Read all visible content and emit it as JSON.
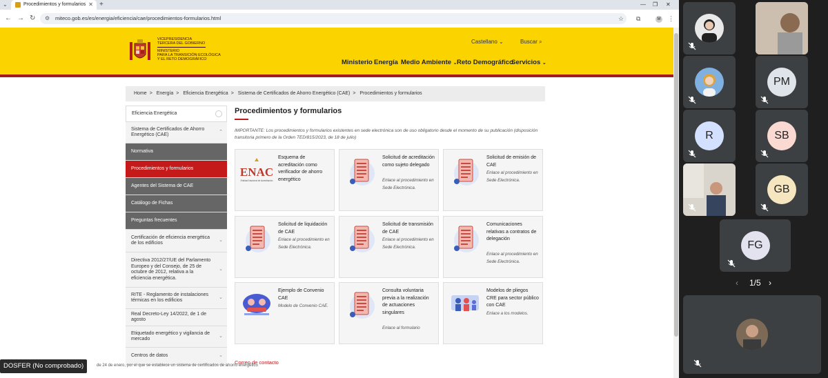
{
  "browser": {
    "tab_title": "Procedimientos y formularios",
    "url": "miteco.gob.es/es/energia/eficiencia/cae/procedimientos-formularios.html",
    "profile_initial": "M"
  },
  "header": {
    "org_line1": "VICEPRESIDENCIA",
    "org_line2": "TERCERA DEL GOBIERNO",
    "org_line3": "MINISTERIO",
    "org_line4": "PARA LA TRANSICIÓN ECOLÓGICA",
    "org_line5": "Y EL RETO DEMOGRÁFICO",
    "language": "Castellano",
    "search": "Buscar",
    "menu": [
      "Ministerio",
      "Energía",
      "Medio Ambiente",
      "Reto Demográfico",
      "Servicios"
    ]
  },
  "breadcrumb": [
    "Home",
    "Energía",
    "Eficiencia Energética",
    "Sistema de Certificados de Ahorro Energético (CAE)",
    "Procedimientos y formularios"
  ],
  "sidebar": [
    "Eficiencia Energética",
    "Sistema de Certificados de Ahorro Energético (CAE)",
    "Normativa",
    "Procedimientos y formularios",
    "Agentes del Sistema de CAE",
    "Catálogo de Fichas",
    "Preguntas frecuentes",
    "Certificación de eficiencia energética de los edificios",
    "Directiva 2012/27/UE del Parlamento Europeo y del Consejo, de 25 de octubre de 2012, relativa a la eficiencia energética.",
    "RITE - Reglamento de instalaciones térmicas en los edificios",
    "Real Decreto-Ley 14/2022, de 1 de agosto",
    "Etiquetado energético y vigilancia de mercado",
    "Centros de datos"
  ],
  "main": {
    "title": "Procedimientos y formularios",
    "notice": "IMPORTANTE: Los procedimientos y formularios existentes en sede electrónica son de uso obligatorio desde el momento de su publicación (disposición transitoria primero de la Orden TED/815/2023, de 18 de julio)",
    "cards": [
      {
        "title": "Esquema de acreditación como verificador de ahorro energético",
        "link": "",
        "icon": "enac-logo"
      },
      {
        "title": "Solicitud de acreditación como sujeto delegado",
        "link": "Enlace al procedimiento en Sede Electrónica.",
        "icon": "form-icon"
      },
      {
        "title": "Solicitud de emisión de CAE",
        "link": "Enlace al procedimiento en Sede Electrónica.",
        "icon": "form-icon"
      },
      {
        "title": "Solicitud de liquidación de CAE",
        "link": "Enlace al procedimiento en Sede Electrónica.",
        "icon": "form-icon"
      },
      {
        "title": "Solicitud de transmisión de CAE",
        "link": "Enlace al procedimiento en Sede Electrónica.",
        "icon": "form-icon"
      },
      {
        "title": "Comunicaciones relativas a contratos de delegación",
        "link": "Enlace al procedimiento en Sede Electrónica.",
        "icon": "form-icon"
      },
      {
        "title": "Ejemplo de Convenio CAE",
        "link": "Modelo de Convenio CAE.",
        "icon": "agreement-icon"
      },
      {
        "title": "Consulta voluntaria previa a la realización de actuaciones singulares",
        "link": "Enlace al formulario",
        "icon": "form-icon"
      },
      {
        "title": "Modelos de pliegos CRE para sector público con CAE",
        "link": "Enlace a los modelos.",
        "icon": "people-icon"
      }
    ],
    "contact": "Correo de contacto",
    "footer_text": "de 24 de enero, por el que se establece un sistema de certificados de ahorro energético",
    "enac_text": "ENAC",
    "enac_sub": "Entidad Nacional de Acreditación"
  },
  "call": {
    "caption": "DOSFER (No comprobado)",
    "participants": [
      "PM",
      "R",
      "SB",
      "GB",
      "FG"
    ],
    "page": "1/5",
    "colors": {
      "PM": "#dfe3ea",
      "R": "#d4e0ff",
      "SB": "#fbd9d3",
      "GB": "#f6e6c0",
      "FG": "#e3e3f0"
    }
  }
}
